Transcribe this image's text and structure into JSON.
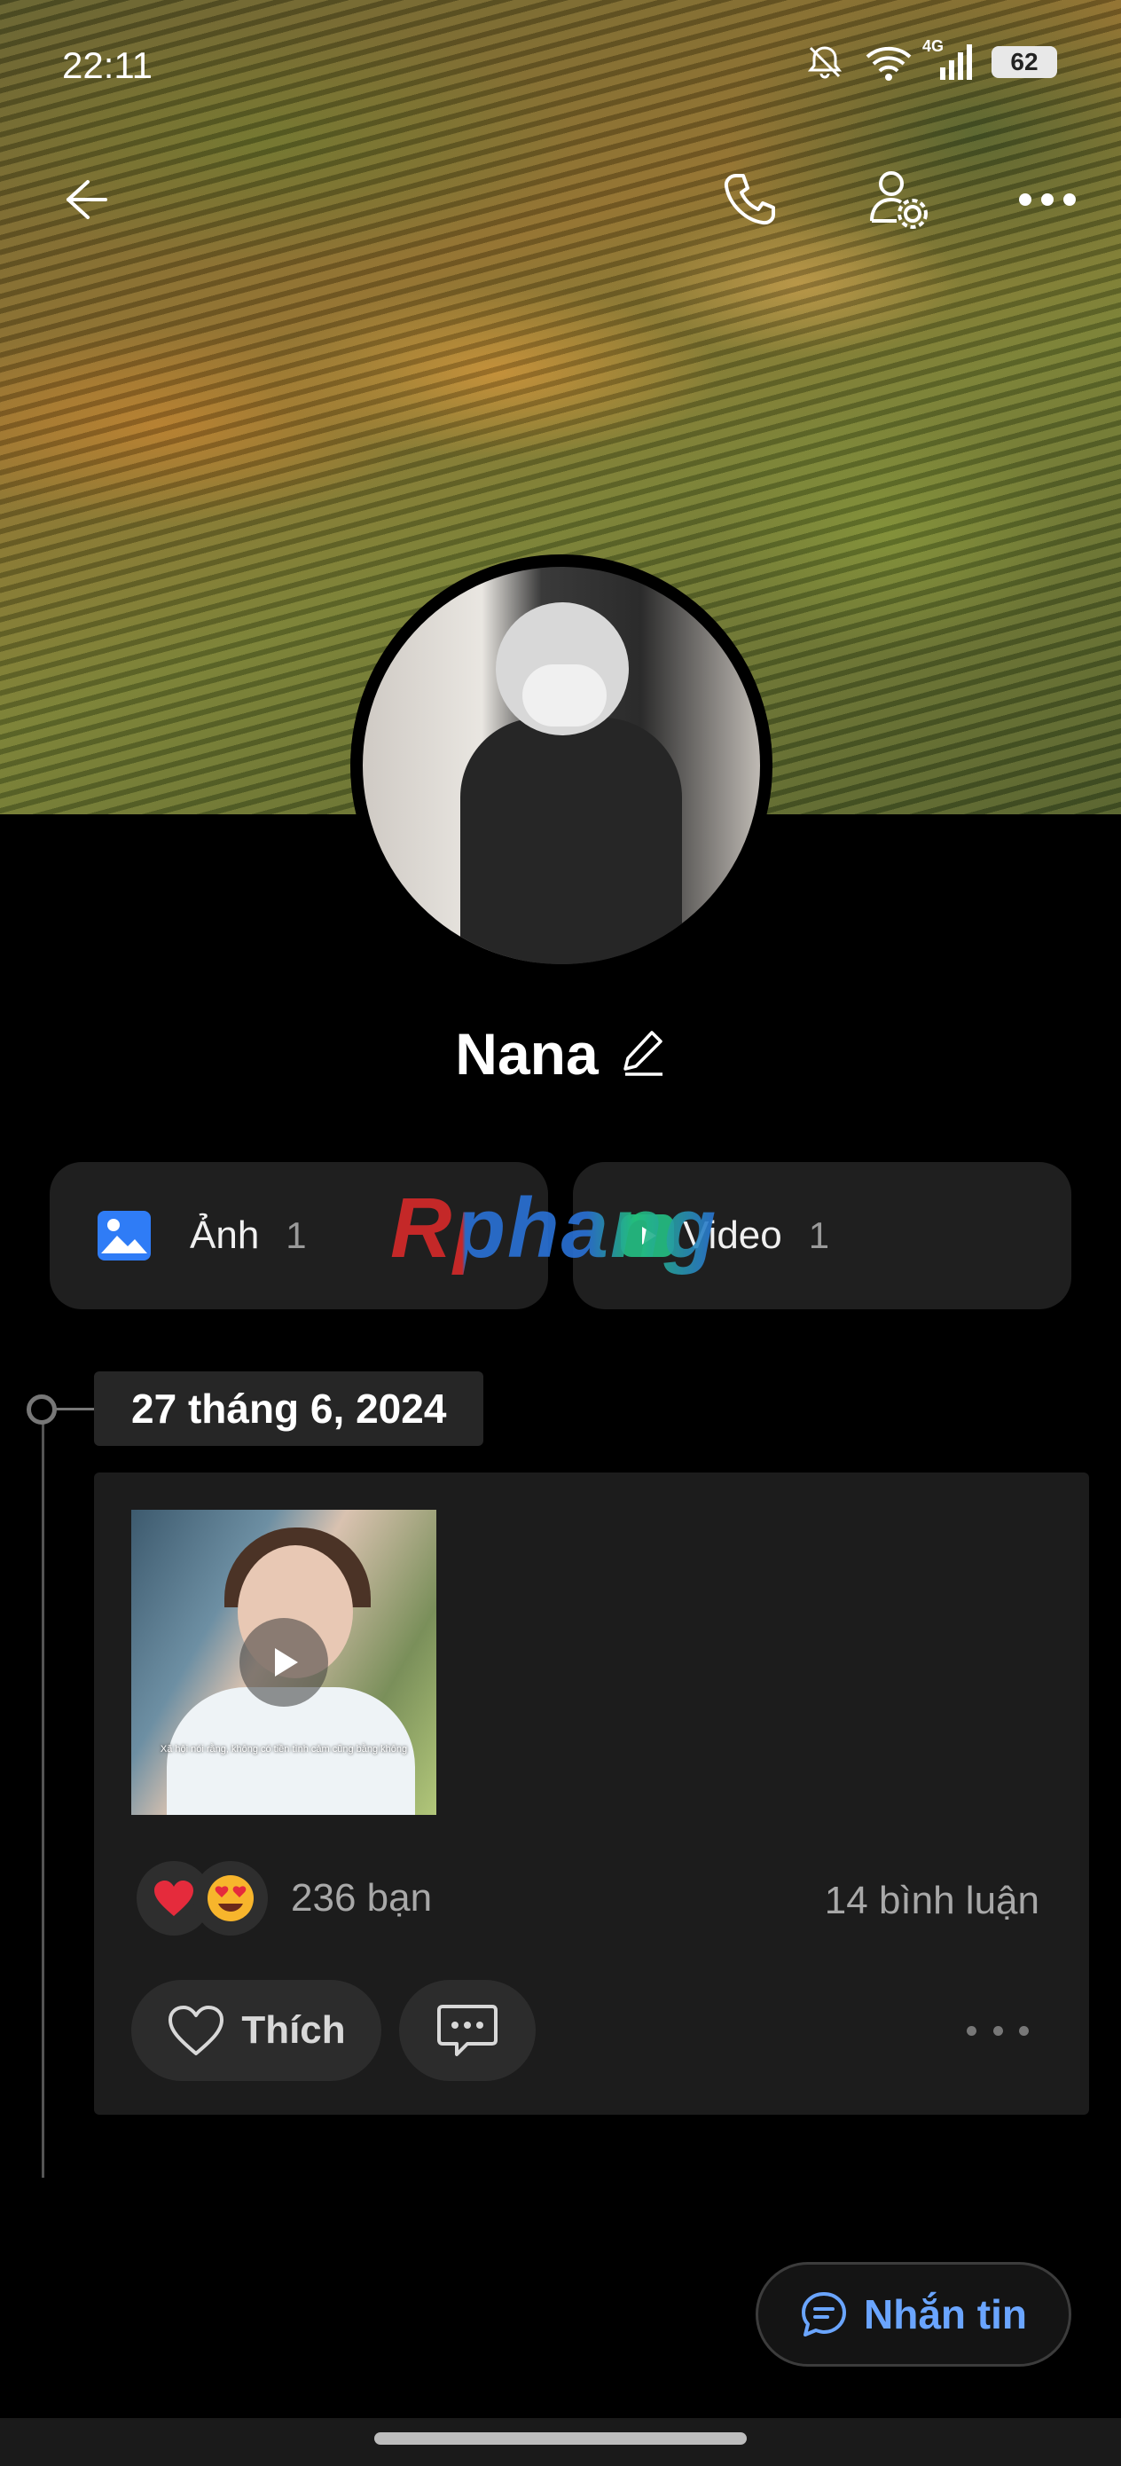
{
  "status_bar": {
    "time": "22:11",
    "network_label": "4G",
    "battery_level": "62"
  },
  "profile": {
    "name": "Nana"
  },
  "media": {
    "photos_label": "Ảnh",
    "photos_count": "1",
    "videos_label": "Video",
    "videos_count": "1"
  },
  "watermark": "Rphang",
  "timeline": {
    "date": "27 tháng 6, 2024"
  },
  "post": {
    "video_caption": "Xã hội nói rằng, không có tiền tình cảm cũng bằng không",
    "reaction_icons": [
      "heart-emoji",
      "heart-eyes-emoji"
    ],
    "reactions_count": "236 bạn",
    "comments_count": "14 bình luận",
    "like_label": "Thích"
  },
  "actions": {
    "message_label": "Nhắn tin"
  },
  "colors": {
    "accent": "#6aa5ff",
    "photo_icon": "#2f7cf6",
    "background": "#000000",
    "card": "#1c1c1c"
  }
}
